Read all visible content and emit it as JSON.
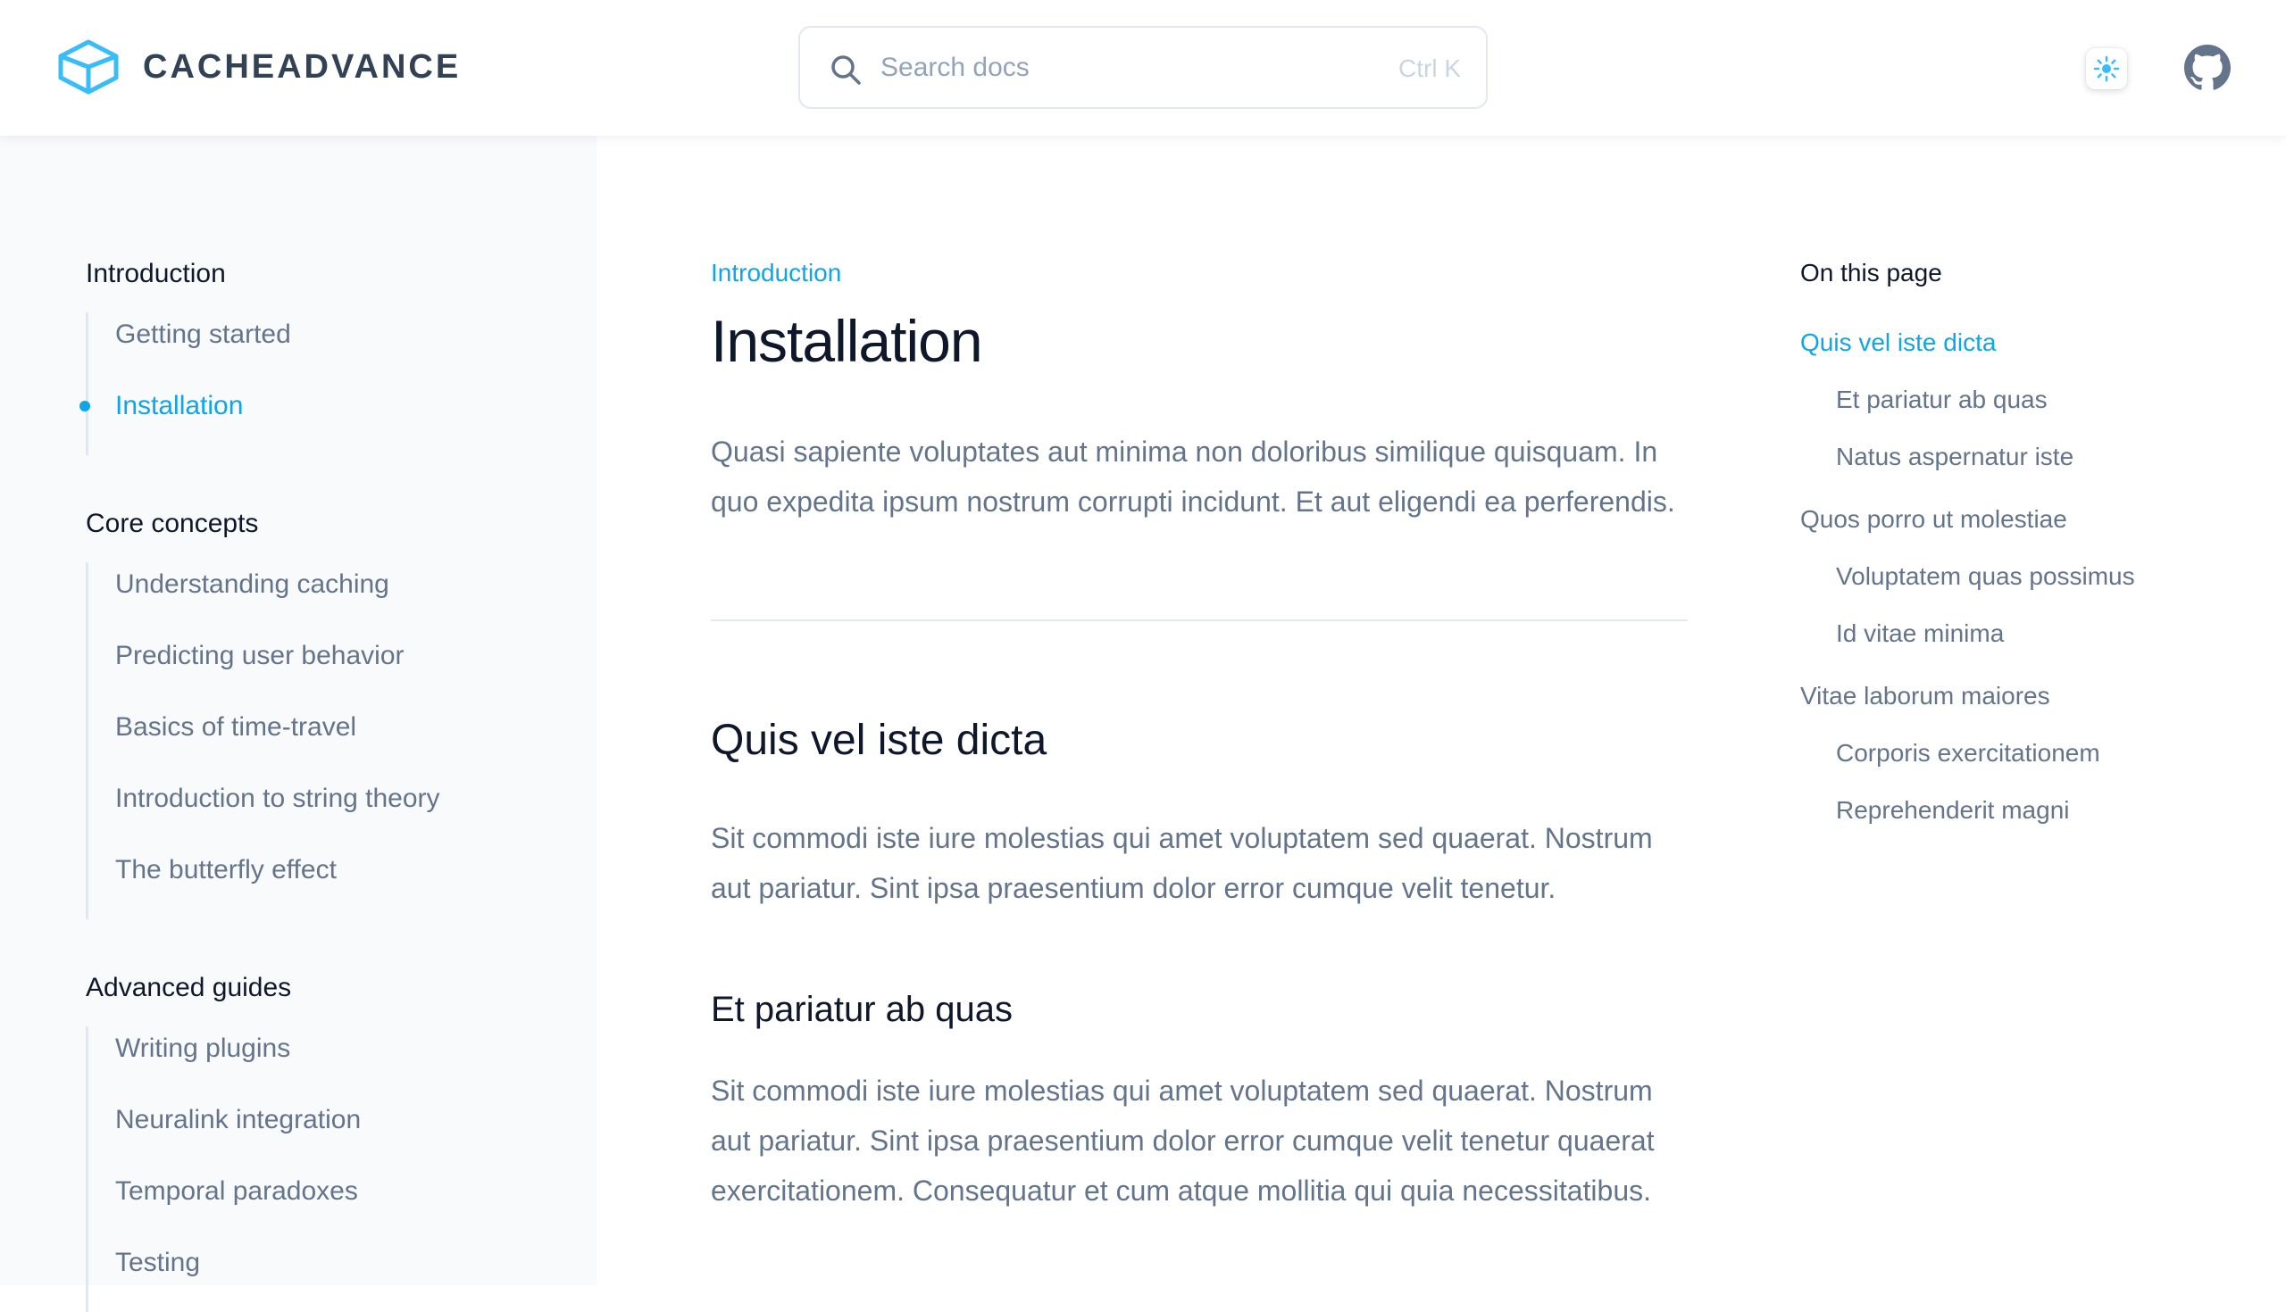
{
  "brand": {
    "name": "CACHEADVANCE"
  },
  "header": {
    "search": {
      "placeholder": "Search docs",
      "shortcut": "Ctrl K"
    },
    "accent_color": "#0ea5e9"
  },
  "sidebar": {
    "sections": [
      {
        "title": "Introduction",
        "items": [
          {
            "label": "Getting started",
            "active": false
          },
          {
            "label": "Installation",
            "active": true
          }
        ]
      },
      {
        "title": "Core concepts",
        "items": [
          {
            "label": "Understanding caching"
          },
          {
            "label": "Predicting user behavior"
          },
          {
            "label": "Basics of time-travel"
          },
          {
            "label": "Introduction to string theory"
          },
          {
            "label": "The butterfly effect"
          }
        ]
      },
      {
        "title": "Advanced guides",
        "items": [
          {
            "label": "Writing plugins"
          },
          {
            "label": "Neuralink integration"
          },
          {
            "label": "Temporal paradoxes"
          },
          {
            "label": "Testing"
          }
        ]
      }
    ]
  },
  "main": {
    "eyebrow": "Introduction",
    "title": "Installation",
    "lead": "Quasi sapiente voluptates aut minima non doloribus similique quisquam. In quo expedita ipsum nostrum corrupti incidunt. Et aut eligendi ea perferendis.",
    "h2": "Quis vel iste dicta",
    "p1": "Sit commodi iste iure molestias qui amet voluptatem sed quaerat. Nostrum aut pariatur. Sint ipsa praesentium dolor error cumque velit tenetur.",
    "h3": "Et pariatur ab quas",
    "p2": "Sit commodi iste iure molestias qui amet voluptatem sed quaerat. Nostrum aut pariatur. Sint ipsa praesentium dolor error cumque velit tenetur quaerat exercitationem. Consequatur et cum atque mollitia qui quia necessitatibus."
  },
  "toc": {
    "title": "On this page",
    "items": [
      {
        "label": "Quis vel iste dicta",
        "level": 1,
        "active": true
      },
      {
        "label": "Et pariatur ab quas",
        "level": 2
      },
      {
        "label": "Natus aspernatur iste",
        "level": 2
      },
      {
        "label": "Quos porro ut molestiae",
        "level": 1
      },
      {
        "label": "Voluptatem quas possimus",
        "level": 2
      },
      {
        "label": "Id vitae minima",
        "level": 2
      },
      {
        "label": "Vitae laborum maiores",
        "level": 1
      },
      {
        "label": "Corporis exercitationem",
        "level": 2
      },
      {
        "label": "Reprehenderit magni",
        "level": 2
      }
    ]
  }
}
